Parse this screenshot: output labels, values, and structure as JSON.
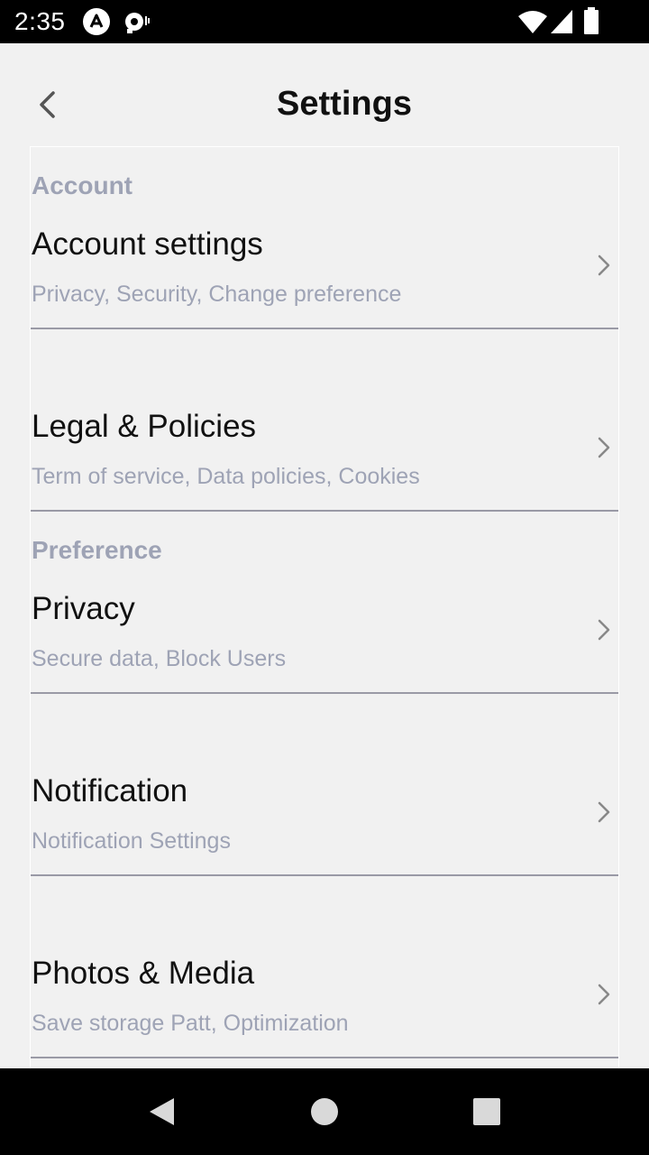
{
  "status_bar": {
    "time": "2:35",
    "icons": [
      "app-notification-icon",
      "media-notification-icon",
      "wifi-icon",
      "cellular-signal-icon",
      "battery-icon"
    ]
  },
  "header": {
    "title": "Settings",
    "back_icon": "chevron-left-icon"
  },
  "items": [
    {
      "section": "Account",
      "title": "Account settings",
      "subtitle": "Privacy, Security, Change preference"
    },
    {
      "section": "",
      "title": "Legal & Policies",
      "subtitle": "Term of service, Data policies, Cookies"
    },
    {
      "section": "Preference",
      "title": "Privacy",
      "subtitle": "Secure data, Block Users"
    },
    {
      "section": "",
      "title": "Notification",
      "subtitle": "Notification Settings"
    },
    {
      "section": "",
      "title": "Photos & Media",
      "subtitle": "Save storage Patt, Optimization"
    }
  ],
  "nav_bar": {
    "buttons": [
      "back-triangle-icon",
      "home-circle-icon",
      "recents-square-icon"
    ]
  },
  "colors": {
    "status_bar_bg": "#000000",
    "background": "#f1f1f1",
    "title_text": "#111111",
    "muted_text": "#9ea3b5",
    "divider": "#9a9aa6"
  }
}
